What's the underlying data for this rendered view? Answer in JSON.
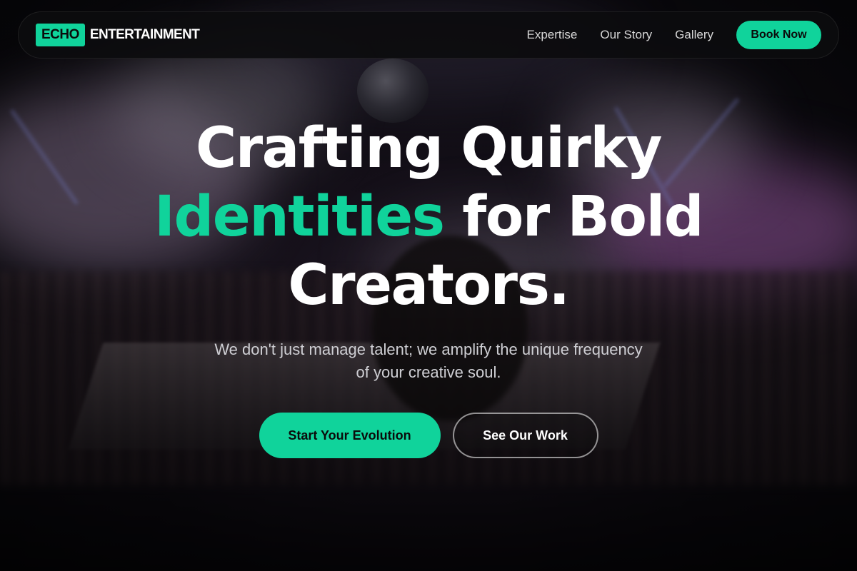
{
  "brand": {
    "box_text": "ECHO",
    "word": "ENTERTAINMENT"
  },
  "nav": {
    "links": [
      "Expertise",
      "Our Story",
      "Gallery"
    ],
    "cta_label": "Book Now"
  },
  "hero": {
    "line1": "Crafting Quirky",
    "line2_accent": "Identities",
    "line2_rest": "for Bold",
    "line3": "Creators.",
    "subtitle": "We don't just manage talent; we amplify the unique frequency of your creative soul.",
    "primary_cta": "Start Your Evolution",
    "secondary_cta": "See Our Work"
  },
  "colors": {
    "accent": "#10d39b",
    "nav_bg": "#0c0c0e",
    "text": "#ffffff"
  }
}
